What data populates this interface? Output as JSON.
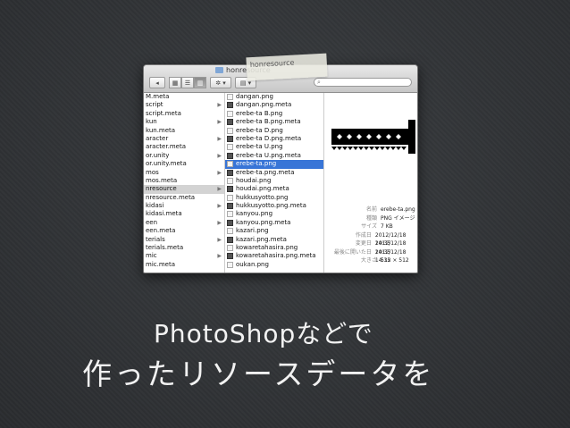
{
  "window": {
    "title": "honresource",
    "search_placeholder": "",
    "toolbar": {
      "view_icons": [
        "icon-view-icon",
        "list-view-icon",
        "column-view-icon"
      ],
      "action_label": "✲ ▾",
      "arrange_label": "▤ ▾"
    }
  },
  "column1": {
    "items": [
      {
        "label": "M.meta"
      },
      {
        "label": "script"
      },
      {
        "label": "script.meta"
      },
      {
        "label": "kun"
      },
      {
        "label": "kun.meta"
      },
      {
        "label": "aracter"
      },
      {
        "label": "aracter.meta"
      },
      {
        "label": "or.unity"
      },
      {
        "label": "or.unity.meta"
      },
      {
        "label": "mos"
      },
      {
        "label": "mos.meta"
      },
      {
        "label": "nresource"
      },
      {
        "label": "nresource.meta"
      },
      {
        "label": "kidasi"
      },
      {
        "label": "kidasi.meta"
      },
      {
        "label": "een"
      },
      {
        "label": "een.meta"
      },
      {
        "label": "terials"
      },
      {
        "label": "terials.meta"
      },
      {
        "label": "mic"
      },
      {
        "label": "mic.meta"
      }
    ]
  },
  "column2": {
    "items": [
      {
        "label": "dangan.png"
      },
      {
        "label": "dangan.png.meta"
      },
      {
        "label": "erebe-ta B.png"
      },
      {
        "label": "erebe-ta B.png.meta"
      },
      {
        "label": "erebe-ta D.png"
      },
      {
        "label": "erebe-ta D.png.meta"
      },
      {
        "label": "erebe-ta U.png"
      },
      {
        "label": "erebe-ta U.png.meta"
      },
      {
        "label": "erebe-ta.png"
      },
      {
        "label": "erebe-ta.png.meta"
      },
      {
        "label": "houdai.png"
      },
      {
        "label": "houdai.png.meta"
      },
      {
        "label": "hukkusyotto.png"
      },
      {
        "label": "hukkusyotto.png.meta"
      },
      {
        "label": "kanyou.png"
      },
      {
        "label": "kanyou.png.meta"
      },
      {
        "label": "kazari.png"
      },
      {
        "label": "kazari.png.meta"
      },
      {
        "label": "kowaretahasira.png"
      },
      {
        "label": "kowaretahasira.png.meta"
      },
      {
        "label": "oukan.png"
      }
    ]
  },
  "info": [
    {
      "label": "名前",
      "value": "erebe-ta.png"
    },
    {
      "label": "種類",
      "value": "PNG イメージ"
    },
    {
      "label": "サイズ",
      "value": "7 KB"
    },
    {
      "label": "作成日",
      "value": "2012/12/18 14:35"
    },
    {
      "label": "変更日",
      "value": "2012/12/18 14:35"
    },
    {
      "label": "最後に開いた日",
      "value": "2012/12/18 14:35"
    },
    {
      "label": "大きさ",
      "value": "512 × 512"
    }
  ],
  "caption": {
    "line1": "PhotoShopなどで",
    "line2": "作ったリソースデータを"
  }
}
